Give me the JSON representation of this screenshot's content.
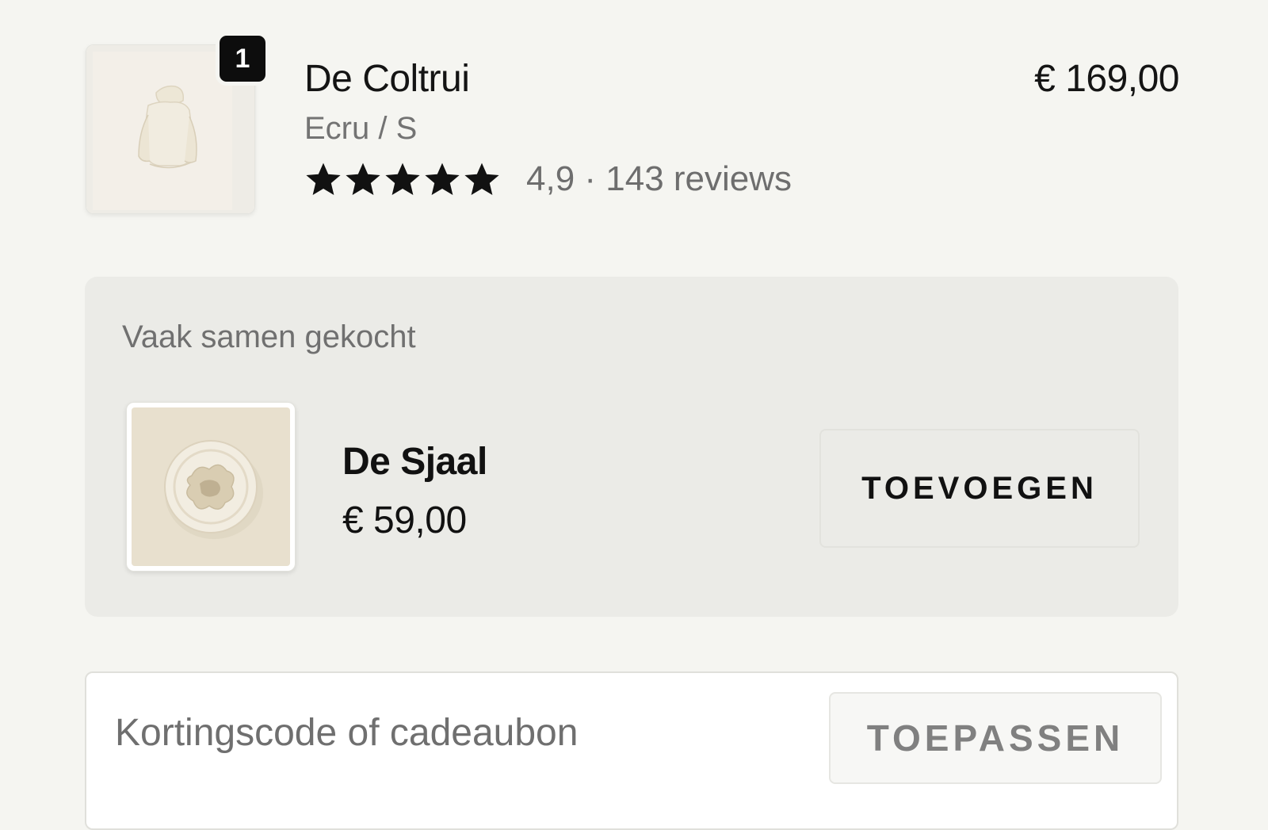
{
  "cart_item": {
    "quantity_badge": "1",
    "title": "De Coltrui",
    "variant": "Ecru / S",
    "rating": {
      "stars_filled": 5,
      "stars_total": 5,
      "text": "4,9 · 143 reviews"
    },
    "price": "€ 169,00",
    "thumbnail_icon": "sweater-product-image"
  },
  "upsell": {
    "heading": "Vaak samen gekocht",
    "product": {
      "name": "De Sjaal",
      "price": "€ 59,00",
      "thumbnail_icon": "scarf-product-image"
    },
    "add_button_label": "TOEVOEGEN"
  },
  "discount": {
    "placeholder": "Kortingscode of cadeaubon",
    "value": "",
    "apply_button_label": "TOEPASSEN"
  },
  "colors": {
    "page_background": "#f5f5f1",
    "panel_background": "#ebebe7",
    "badge_background": "#0d0d0d",
    "star_color": "#111111",
    "muted_text": "#737373"
  }
}
